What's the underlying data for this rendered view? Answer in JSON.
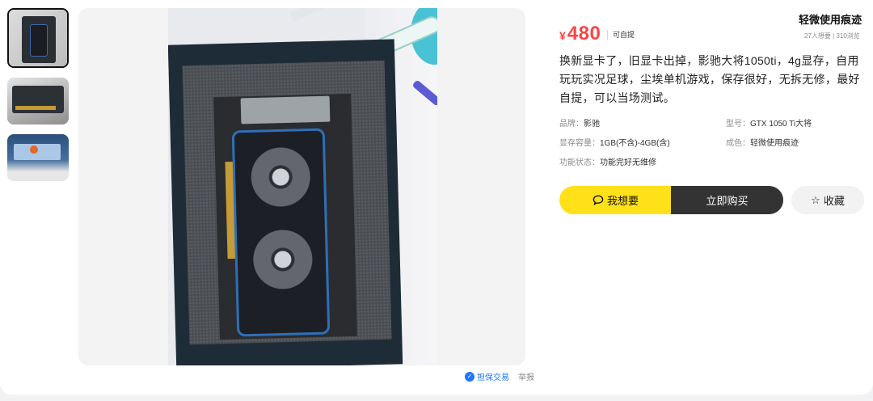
{
  "listing": {
    "price_currency": "¥",
    "price_value": "480",
    "pickup": "可自提",
    "condition": "轻微使用痕迹",
    "stats": "27人想要 | 310浏览",
    "description": "换新显卡了，旧显卡出掉，影驰大将1050ti，4g显存，自用玩玩实况足球，尘埃单机游戏，保存很好，无拆无修，最好自提，可以当场测试。",
    "attributes": [
      {
        "label": "品牌：",
        "value": "影驰"
      },
      {
        "label": "型号：",
        "value": "GTX 1050 Ti大将"
      },
      {
        "label": "显存容量：",
        "value": "1GB(不含)-4GB(含)"
      },
      {
        "label": "成色：",
        "value": "轻微使用痕迹"
      },
      {
        "label": "功能状态：",
        "value": "功能完好无维修"
      }
    ]
  },
  "actions": {
    "want_label": "我想要",
    "buy_label": "立即购买",
    "favorite_label": "收藏"
  },
  "footer": {
    "assurance_label": "担保交易",
    "report_label": "举报"
  },
  "icons": {
    "chat": "chat-bubble-icon",
    "star": "star-icon",
    "assurance": "shield-icon"
  },
  "colors": {
    "price": "#ff4444",
    "accent_yellow": "#ffe11a",
    "buy_button": "#333333",
    "assurance_blue": "#1f75ff"
  }
}
